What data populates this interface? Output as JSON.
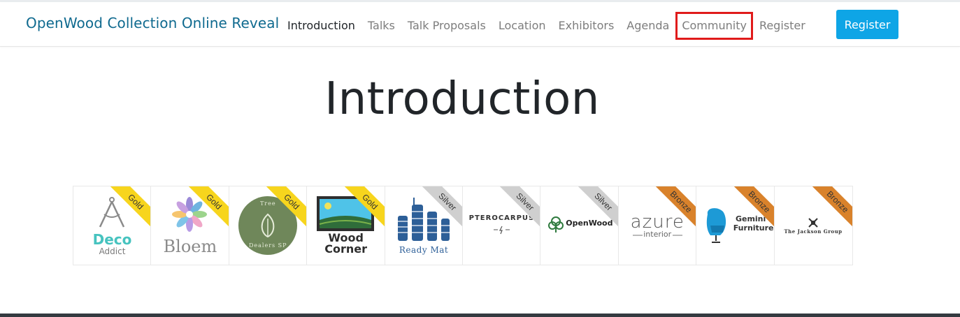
{
  "brand": "OpenWood Collection Online Reveal",
  "nav": {
    "items": [
      {
        "label": "Introduction",
        "active": true
      },
      {
        "label": "Talks"
      },
      {
        "label": "Talk Proposals"
      },
      {
        "label": "Location"
      },
      {
        "label": "Exhibitors"
      },
      {
        "label": "Agenda"
      },
      {
        "label": "Community",
        "highlighted": true
      },
      {
        "label": "Register"
      }
    ],
    "cta_label": "Register"
  },
  "page": {
    "title": "Introduction"
  },
  "colors": {
    "brand": "#0f6a8f",
    "cta": "#0ea5e6",
    "gold": "#f7d51d",
    "silver": "#cfcfcf",
    "bronze": "#d9822b",
    "highlight": "#e01b1b"
  },
  "sponsors": [
    {
      "tier": "Gold",
      "logo": [
        "Deco",
        "Addict"
      ]
    },
    {
      "tier": "Gold",
      "logo": [
        "Bloem"
      ]
    },
    {
      "tier": "Gold",
      "logo": [
        "Tree",
        "Dealers SP"
      ]
    },
    {
      "tier": "Gold",
      "logo": [
        "Wood",
        "Corner"
      ]
    },
    {
      "tier": "Silver",
      "logo": [
        "Ready Mat"
      ]
    },
    {
      "tier": "Silver",
      "logo": [
        "PTEROCARPUS"
      ]
    },
    {
      "tier": "Silver",
      "logo": [
        "OpenWood"
      ]
    },
    {
      "tier": "Bronze",
      "logo": [
        "azure",
        "interior"
      ]
    },
    {
      "tier": "Bronze",
      "logo": [
        "Gemini",
        "Furniture"
      ]
    },
    {
      "tier": "Bronze",
      "logo": [
        "The Jackson Group"
      ]
    }
  ]
}
